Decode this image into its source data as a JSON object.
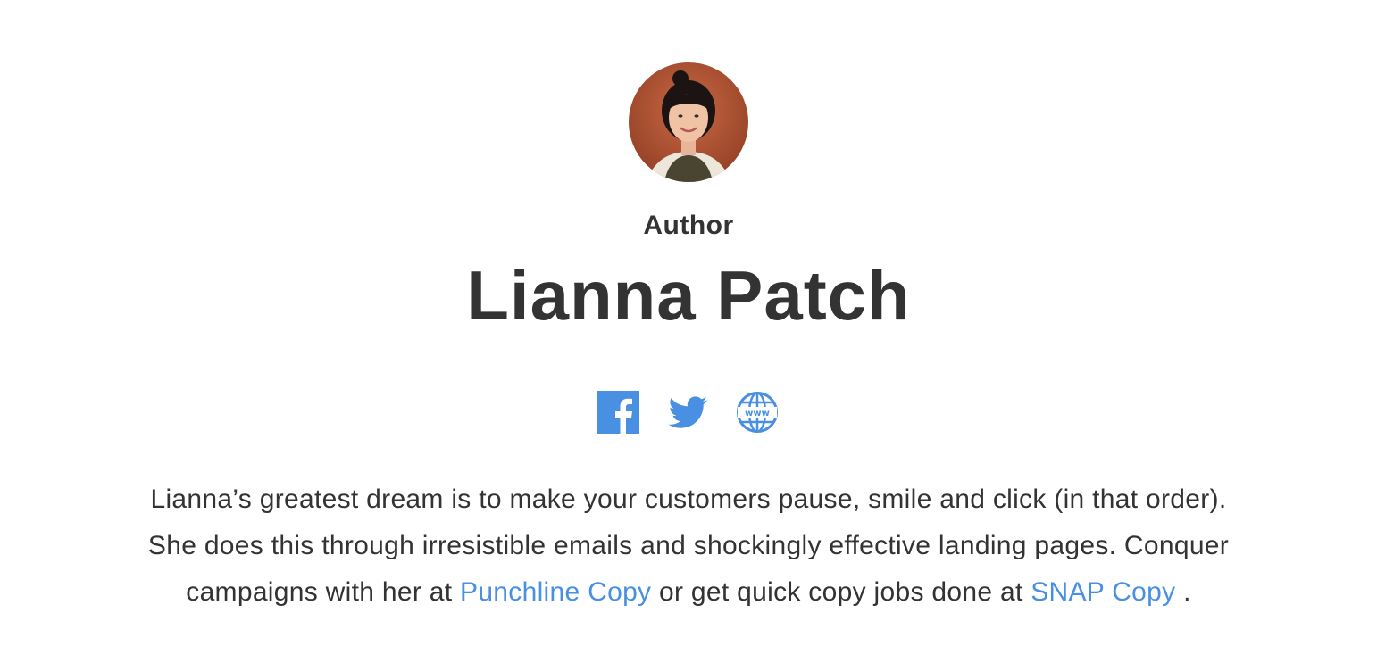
{
  "author": {
    "eyebrow": "Author",
    "name": "Lianna Patch",
    "avatar_icon": "author-portrait",
    "social": [
      {
        "icon": "facebook-icon",
        "color": "#4a90e2"
      },
      {
        "icon": "twitter-icon",
        "color": "#4a90e2"
      },
      {
        "icon": "website-globe-icon",
        "color": "#4a90e2"
      }
    ],
    "bio": {
      "line1": "Lianna’s greatest dream is to make your customers pause, smile and click (in that order).",
      "line2": "She does this through irresistible emails and shockingly effective landing pages. Conquer",
      "line3_prefix": "campaigns with her at ",
      "link1": "Punchline Copy",
      "line3_middle": " or get quick copy jobs done at ",
      "link2": "SNAP Copy",
      "line3_suffix": " ."
    }
  },
  "colors": {
    "text": "#333333",
    "link": "#4a90e2",
    "background": "#ffffff"
  }
}
